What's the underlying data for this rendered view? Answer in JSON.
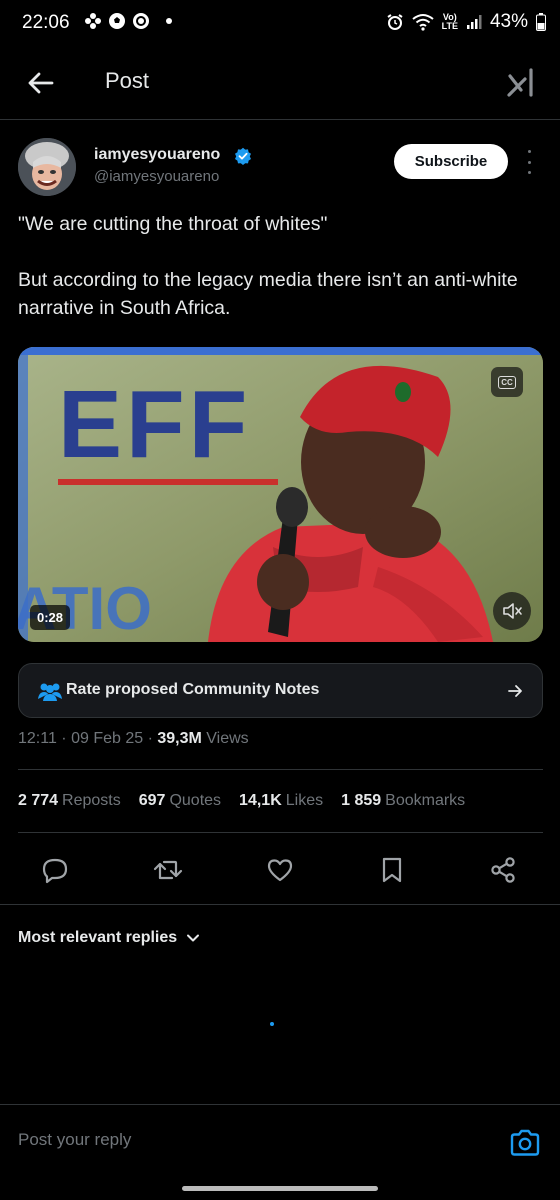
{
  "status_bar": {
    "time": "22:06",
    "network_label": "Vo)\nLTE",
    "battery": "43%"
  },
  "header": {
    "title": "Post",
    "back_icon": "arrow-left-icon",
    "grok_icon": "grok-icon"
  },
  "post": {
    "author": {
      "display_name": "iamyesyouareno",
      "handle": "@iamyesyouareno",
      "verified": true
    },
    "subscribe_label": "Subscribe",
    "text": "\"We are cutting the throat of whites\"\n\nBut according to the legacy media there isn’t an anti-white narrative in South Africa.",
    "media": {
      "duration": "0:28",
      "cc_label": "CC",
      "banner_text": "EFF",
      "banner_text_lower": "ATIO"
    },
    "community_notes_label": "Rate proposed Community Notes",
    "timestamp": "12:11 · 09 Feb 25 · ",
    "views_count": "39,3M",
    "views_label": " Views",
    "stats": {
      "reposts_count": "2 774",
      "reposts_label": "Reposts",
      "quotes_count": "697",
      "quotes_label": "Quotes",
      "likes_count": "14,1K",
      "likes_label": "Likes",
      "bookmarks_count": "1 859",
      "bookmarks_label": "Bookmarks"
    }
  },
  "replies": {
    "sort_label": "Most relevant replies",
    "reply_placeholder": "Post your reply"
  },
  "colors": {
    "background": "#000000",
    "text_primary": "#e7e9ea",
    "text_secondary": "#71767b",
    "accent": "#1d9bf0",
    "border": "#2f3336"
  }
}
